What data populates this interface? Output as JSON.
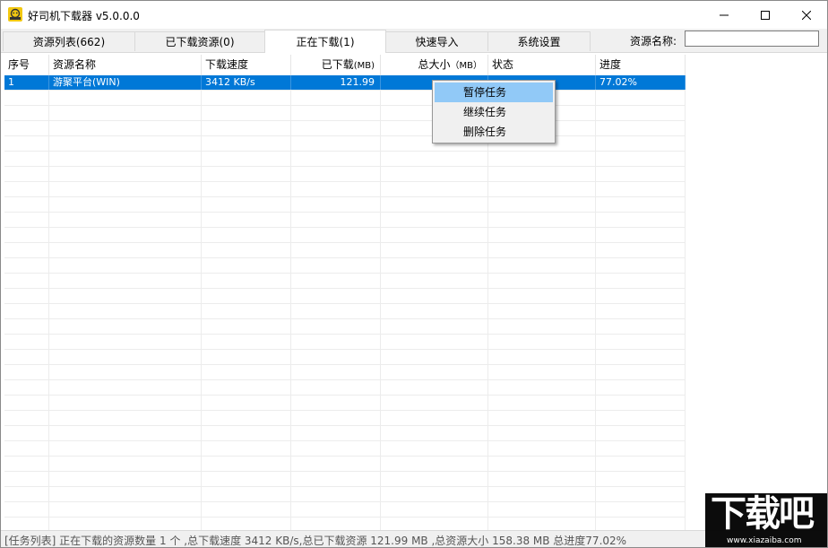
{
  "window": {
    "title": "好司机下载器 v5.0.0.0"
  },
  "tabs": [
    {
      "label": "资源列表(662)",
      "active": false
    },
    {
      "label": "已下载资源(0)",
      "active": false
    },
    {
      "label": "正在下载(1)",
      "active": true
    },
    {
      "label": "快速导入",
      "active": false
    },
    {
      "label": "系统设置",
      "active": false
    }
  ],
  "search": {
    "label": "资源名称:",
    "value": "",
    "placeholder": ""
  },
  "table": {
    "columns": [
      "序号",
      "资源名称",
      "下载速度",
      "已下载",
      "总大小",
      "状态",
      "进度"
    ],
    "units": {
      "downloaded": "(MB)",
      "total": "（MB）"
    },
    "rows": [
      {
        "index": "1",
        "name": "游聚平台(WIN)",
        "speed": "3412 KB/s",
        "downloaded": "121.99",
        "total": "",
        "status": "",
        "progress": "77.02%"
      }
    ]
  },
  "context_menu": {
    "items": [
      "暂停任务",
      "继续任务",
      "删除任务"
    ],
    "highlighted": 0
  },
  "status_bar": {
    "text": "[任务列表] 正在下载的资源数量 1 个 ,总下载速度 3412 KB/s,总已下载资源 121.99 MB ,总资源大小 158.38 MB 总进度77.02%"
  },
  "watermark": {
    "logo": "下载吧",
    "site": "www.xiazaiba.com"
  },
  "colors": {
    "selection": "#0078d7",
    "menu_highlight": "#91c9f7",
    "chrome": "#f0f0f0"
  }
}
